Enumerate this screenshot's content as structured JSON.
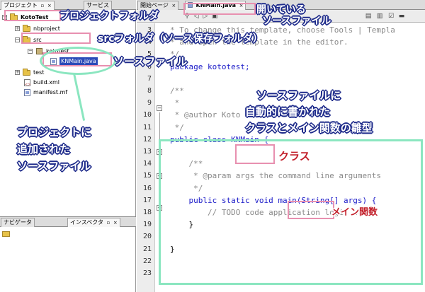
{
  "left_panel": {
    "tabs": [
      "プロジェクト",
      "サービス"
    ],
    "tree": [
      {
        "label": "KotoTest",
        "icon": "project-icon"
      },
      {
        "label": "nbproject",
        "icon": "folder-icon"
      },
      {
        "label": "src",
        "icon": "folder-icon"
      },
      {
        "label": "kototest",
        "icon": "package-icon"
      },
      {
        "label": "KNMain.java",
        "icon": "java-file-icon"
      },
      {
        "label": "test",
        "icon": "folder-icon"
      },
      {
        "label": "build.xml",
        "icon": "xml-file-icon"
      },
      {
        "label": "manifest.mf",
        "icon": "file-icon"
      }
    ],
    "bottom_tabs": [
      "ナビゲータ",
      "インスペクタ"
    ]
  },
  "editor": {
    "tabs": [
      "開始ページ",
      "KNMain.java"
    ],
    "line_numbers": [
      "3",
      "4",
      "5",
      "6",
      "7",
      "8",
      "9",
      "10",
      "11",
      "12",
      "13",
      "14",
      "15",
      "16",
      "17",
      "18",
      "19",
      "20",
      "21",
      "22",
      "23"
    ],
    "lines": [
      "* To change this template, choose Tools | Templa",
      "* and open the template in the editor.",
      "*/",
      "package kototest;",
      "",
      "/**",
      " *",
      " * @author Koto",
      " */",
      "public class KNMain {",
      "",
      "    /**",
      "     * @param args the command line arguments",
      "     */",
      "    public static void main(String[] args) {",
      "        // TODO code application logic here",
      "    }",
      "",
      "}",
      "",
      ""
    ]
  },
  "annotations": {
    "project_folder": "プロジェクトフォルダ",
    "src_folder": "srcフォルダ（ソース保存フォルダ）",
    "source_file": "ソースファイル",
    "open_source_l1": "開いている",
    "open_source_l2": "ソースファイル",
    "added_source_l1": "プロジェクトに",
    "added_source_l2": "追加された",
    "added_source_l3": "ソースファイル",
    "auto_written_l1": "ソースファイルに",
    "auto_written_l2": "自動的に書かれた",
    "auto_written_l3": "クラスとメイン関数の雛型",
    "class_label": "クラス",
    "main_label": "メイン関数"
  },
  "colors": {
    "annotation_box": "#e890b0",
    "highlight_frame": "#8be6c0",
    "callout_outline": "#1d2a8a",
    "callout_red": "#c21f2a",
    "keyword": "#1a1ac8",
    "comment": "#8a8a8a",
    "selection": "#2b4bb8"
  }
}
